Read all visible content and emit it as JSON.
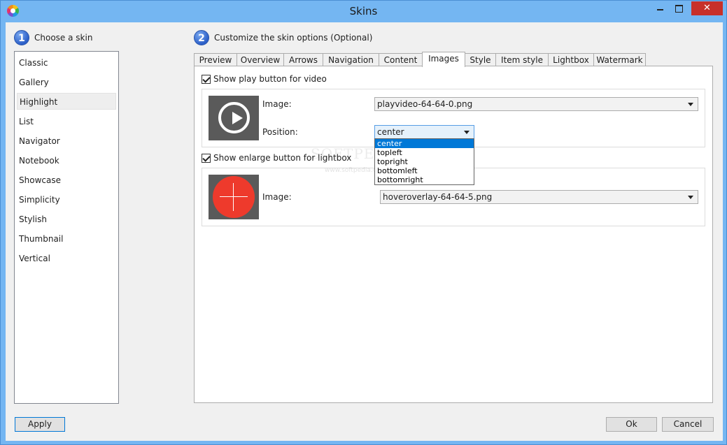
{
  "window": {
    "title": "Skins",
    "icons": {
      "app": "app-logo-icon",
      "minimize": "minimize-icon",
      "maximize": "maximize-icon",
      "close": "close-icon"
    },
    "close_glyph": "✕"
  },
  "steps": {
    "one": {
      "number": "1",
      "label": "Choose a skin"
    },
    "two": {
      "number": "2",
      "label": "Customize the skin options (Optional)"
    }
  },
  "skins": [
    "Classic",
    "Gallery",
    "Highlight",
    "List",
    "Navigator",
    "Notebook",
    "Showcase",
    "Simplicity",
    "Stylish",
    "Thumbnail",
    "Vertical"
  ],
  "selected_skin": "Highlight",
  "tabs": [
    "Preview",
    "Overview",
    "Arrows",
    "Navigation",
    "Content",
    "Images",
    "Style",
    "Item style",
    "Lightbox",
    "Watermark"
  ],
  "active_tab": "Images",
  "images_tab": {
    "play_button": {
      "checkbox_label": "Show play button for video",
      "checked": true,
      "image_label": "Image:",
      "image_value": "playvideo-64-64-0.png",
      "position_label": "Position:",
      "position_value": "center",
      "position_options": [
        "center",
        "topleft",
        "topright",
        "bottomleft",
        "bottomright"
      ]
    },
    "enlarge_button": {
      "checkbox_label": "Show enlarge button for lightbox",
      "checked": true,
      "image_label": "Image:",
      "image_value": "hoveroverlay-64-64-5.png"
    }
  },
  "watermark": {
    "big": "SOFTPEDIA",
    "small": "www.softpedia.com"
  },
  "buttons": {
    "apply": "Apply",
    "ok": "Ok",
    "cancel": "Cancel"
  },
  "colors": {
    "accent": "#0078d7",
    "frame": "#74b6f2",
    "close": "#c7302a",
    "overlay_red": "#ee3a2c"
  }
}
